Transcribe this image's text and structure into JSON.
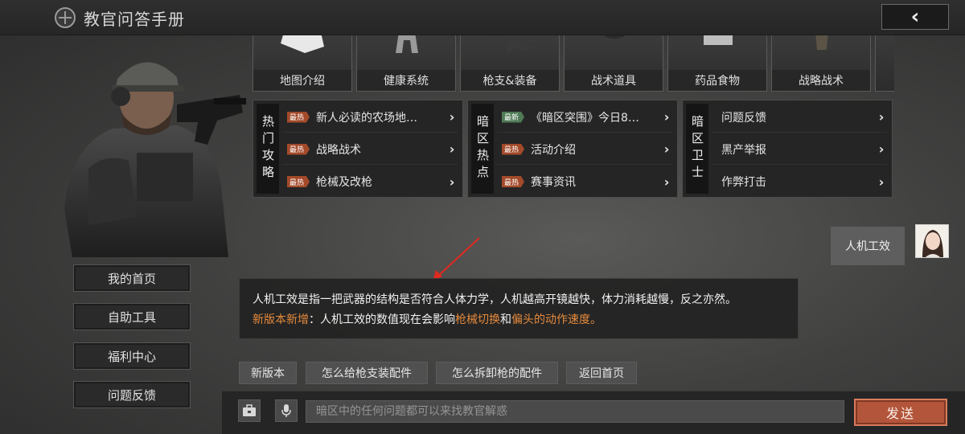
{
  "header": {
    "title": "教官问答手册",
    "back_icon": "‹"
  },
  "sidebar": {
    "items": [
      {
        "label": "我的首页"
      },
      {
        "label": "自助工具"
      },
      {
        "label": "福利中心"
      },
      {
        "label": "问题反馈"
      }
    ]
  },
  "categories": [
    {
      "label": "地图介绍",
      "icon": "map-icon"
    },
    {
      "label": "健康系统",
      "icon": "body-icon"
    },
    {
      "label": "枪支&装备",
      "icon": "gun-icon"
    },
    {
      "label": "战术道具",
      "icon": "tactical-icon"
    },
    {
      "label": "药品食物",
      "icon": "medicine-icon"
    },
    {
      "label": "战略战术",
      "icon": "strategy-icon"
    }
  ],
  "panels": [
    {
      "title": "热门攻略",
      "rows": [
        {
          "badge": "最热",
          "text": "新人必读的农场地…"
        },
        {
          "badge": "最热",
          "text": "战略战术"
        },
        {
          "badge": "最热",
          "text": "枪械及改枪"
        }
      ]
    },
    {
      "title": "暗区热点",
      "rows": [
        {
          "badge": "最新",
          "text": "《暗区突围》今日8…"
        },
        {
          "badge": "最热",
          "text": "活动介绍"
        },
        {
          "badge": "最热",
          "text": "赛事资讯"
        }
      ]
    },
    {
      "title": "暗区卫士",
      "rows": [
        {
          "badge": "",
          "text": "问题反馈"
        },
        {
          "badge": "",
          "text": "黑产举报"
        },
        {
          "badge": "",
          "text": "作弊打击"
        }
      ]
    }
  ],
  "chat": {
    "user_message": "人机工效",
    "answer_line1": "人机工效是指一把武器的结构是否符合人体力学，人机越高开镜越快，体力消耗越慢，反之亦然。",
    "answer_line2_prefix": "新版本新增",
    "answer_line2_mid": "：人机工效的数值现在会影响",
    "answer_line2_link1": "枪械切换",
    "answer_line2_and": "和",
    "answer_line2_link2": "偏头的动作速度。"
  },
  "quick_replies": [
    "新版本",
    "怎么给枪支装配件",
    "怎么拆卸枪的配件",
    "返回首页"
  ],
  "input": {
    "placeholder": "暗区中的任何问题都可以来找教官解惑"
  },
  "send_label": "发送",
  "colors": {
    "accent_orange": "#e68a3c",
    "badge_hot": "#a34a2a",
    "badge_new": "#4f7a55",
    "send_button": "#b2553a",
    "annotation_arrow": "#e02a1f"
  }
}
